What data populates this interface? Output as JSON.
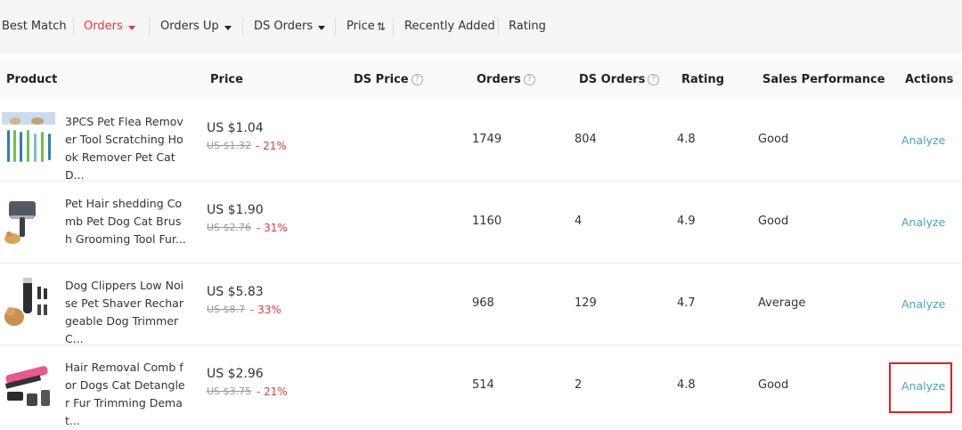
{
  "sort_bar": {
    "best_match": "Best Match",
    "orders": "Orders",
    "orders_up": "Orders Up",
    "ds_orders": "DS Orders",
    "price": "Price",
    "recently_added": "Recently Added",
    "rating": "Rating"
  },
  "table": {
    "headers": {
      "product": "Product",
      "price": "Price",
      "ds_price": "DS Price",
      "orders": "Orders",
      "ds_orders": "DS Orders",
      "rating": "Rating",
      "sales_performance": "Sales Performance",
      "actions": "Actions"
    },
    "rows": [
      {
        "name": "3PCS Pet Flea Remover Tool Scratching Hook Remover Pet Cat D...",
        "price": "US $1.04",
        "old_price": "US $1.32",
        "discount": "- 21%",
        "ds_price": "",
        "orders": "1749",
        "ds_orders": "804",
        "rating": "4.8",
        "sales_performance": "Good",
        "action": "Analyze"
      },
      {
        "name": "Pet Hair shedding Comb Pet Dog Cat Brush Grooming Tool Fur...",
        "price": "US $1.90",
        "old_price": "US $2.76",
        "discount": "- 31%",
        "ds_price": "",
        "orders": "1160",
        "ds_orders": "4",
        "rating": "4.9",
        "sales_performance": "Good",
        "action": "Analyze"
      },
      {
        "name": "Dog Clippers Low Noise Pet Shaver Rechargeable Dog Trimmer C...",
        "price": "US $5.83",
        "old_price": "US $8.7",
        "discount": "- 33%",
        "ds_price": "",
        "orders": "968",
        "ds_orders": "129",
        "rating": "4.7",
        "sales_performance": "Average",
        "action": "Analyze"
      },
      {
        "name": "Hair Removal Comb for Dogs Cat Detangler Fur Trimming Demat...",
        "price": "US $2.96",
        "old_price": "US $3.75",
        "discount": "- 21%",
        "ds_price": "",
        "orders": "514",
        "ds_orders": "2",
        "rating": "4.8",
        "sales_performance": "Good",
        "action": "Analyze"
      }
    ]
  },
  "colors": {
    "accent_red": "#e4393c",
    "link_teal": "#4aa3b5",
    "highlight_box": "#e02020"
  },
  "icons": {
    "sort_caret": "caret-down-icon",
    "price_sort": "sort-arrows-icon",
    "help": "question-circle-icon"
  }
}
